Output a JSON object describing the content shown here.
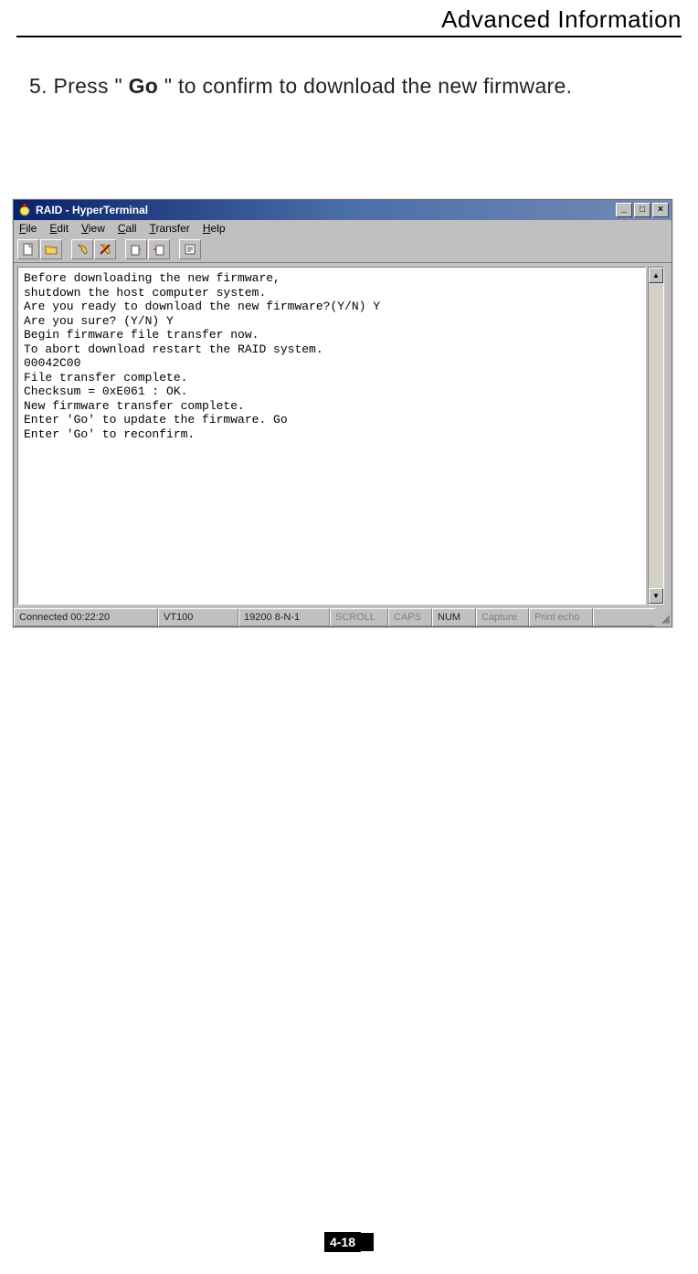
{
  "header": {
    "title": "Advanced Information"
  },
  "instruction": {
    "prefix": "5. Press \" ",
    "keyword": "Go",
    "suffix": " \"  to confirm to download the new firmware."
  },
  "window": {
    "title": "RAID - HyperTerminal",
    "menus": [
      "File",
      "Edit",
      "View",
      "Call",
      "Transfer",
      "Help"
    ],
    "terminal_lines": [
      "Before downloading the new firmware,",
      "shutdown the host computer system.",
      "Are you ready to download the new firmware?(Y/N) Y",
      "Are you sure? (Y/N) Y",
      "Begin firmware file transfer now.",
      "To abort download restart the RAID system.",
      "00042C00",
      "File transfer complete.",
      "Checksum = 0xE061 : OK.",
      "New firmware transfer complete.",
      "Enter 'Go' to update the firmware. Go",
      "Enter 'Go' to reconfirm."
    ],
    "status": {
      "connected": "Connected 00:22:20",
      "emulation": "VT100",
      "port": "19200 8-N-1",
      "scroll": "SCROLL",
      "caps": "CAPS",
      "num": "NUM",
      "capture": "Capture",
      "printecho": "Print echo"
    }
  },
  "footer": {
    "page_number": "4-18"
  }
}
